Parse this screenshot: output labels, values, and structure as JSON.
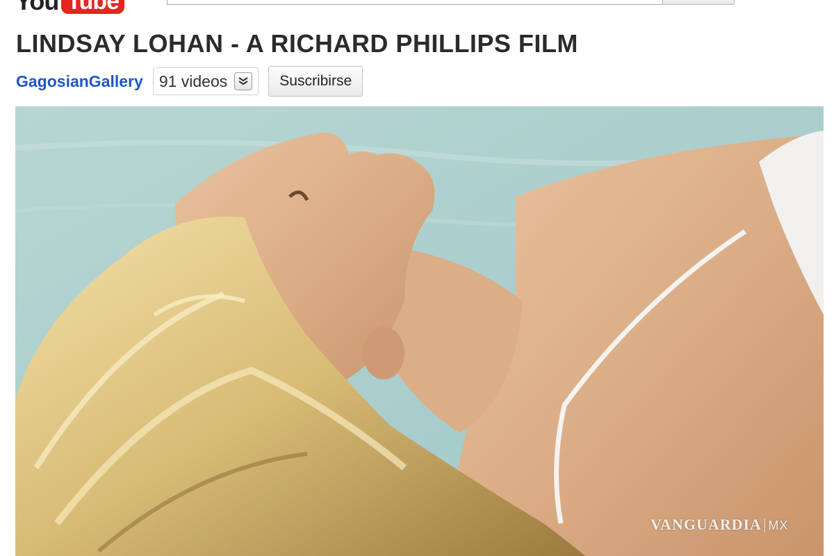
{
  "header": {
    "logo_you": "You",
    "logo_tube": "Tube"
  },
  "video": {
    "title": "LINDSAY LOHAN - A RICHARD PHILLIPS FILM",
    "channel": "GagosianGallery",
    "video_count": "91 videos",
    "subscribe_label": "Suscribirse"
  },
  "watermark": {
    "brand": "VANGUARDIA",
    "separator": "|",
    "tld": "MX"
  },
  "colors": {
    "logo_red": "#e3261f",
    "channel_link": "#1f56c8",
    "title_text": "#2b2b2b"
  },
  "icons": {
    "dropdown": "chevron-down-icon"
  }
}
